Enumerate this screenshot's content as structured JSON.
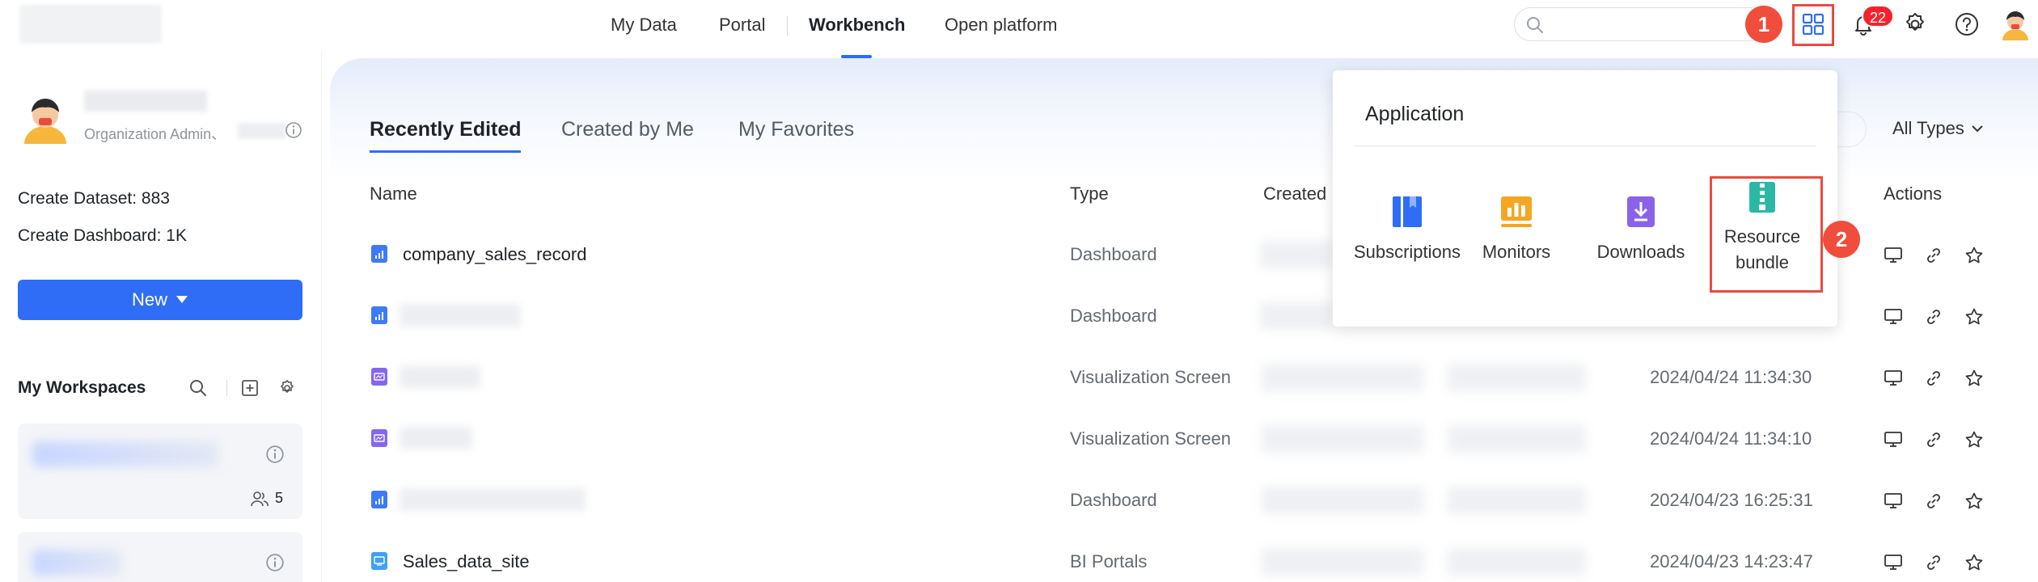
{
  "nav": {
    "items": [
      {
        "label": "My Data",
        "active": false
      },
      {
        "label": "Portal",
        "active": false
      },
      {
        "label": "Workbench",
        "active": true
      },
      {
        "label": "Open platform",
        "active": false
      }
    ]
  },
  "header": {
    "search_placeholder": "",
    "notification_count": "22",
    "markers": [
      "1",
      "2"
    ],
    "icons": [
      "search-icon",
      "apps-grid-icon",
      "bell-icon",
      "settings-icon",
      "help-icon",
      "avatar"
    ]
  },
  "profile": {
    "role": "Organization Admin、",
    "stats": {
      "dataset_label": "Create Dataset:",
      "dataset_value": "883",
      "dashboard_label": "Create Dashboard:",
      "dashboard_value": "1K"
    }
  },
  "sidebar": {
    "new_label": "New",
    "workspaces_title": "My Workspaces",
    "workspace_cards": [
      {
        "members": "5"
      },
      {
        "members": ""
      }
    ]
  },
  "main": {
    "tabs": [
      {
        "label": "Recently Edited",
        "active": true
      },
      {
        "label": "Created by Me",
        "active": false
      },
      {
        "label": "My Favorites",
        "active": false
      }
    ],
    "filter_label": "All Types",
    "columns": [
      "Name",
      "Type",
      "Created",
      "Actions"
    ],
    "rows": [
      {
        "name": "company_sales_record",
        "type": "Dashboard",
        "icon": "dashboard-icon",
        "date": ""
      },
      {
        "name": "",
        "type": "Dashboard",
        "icon": "dashboard-icon",
        "date": ""
      },
      {
        "name": "",
        "type": "Visualization Screen",
        "icon": "visualization-screen-icon",
        "date": "2024/04/24 11:34:30"
      },
      {
        "name": "",
        "type": "Visualization Screen",
        "icon": "visualization-screen-icon",
        "date": "2024/04/24 11:34:10"
      },
      {
        "name": "",
        "type": "Dashboard",
        "icon": "dashboard-icon",
        "date": "2024/04/23 16:25:31"
      },
      {
        "name": "Sales_data_site",
        "type": "BI Portals",
        "icon": "bi-portal-icon",
        "date": "2024/04/23 14:23:47"
      }
    ]
  },
  "popup": {
    "title": "Application",
    "apps": [
      {
        "label": "Subscriptions",
        "icon": "subscriptions-icon",
        "color": "#2f6df6"
      },
      {
        "label": "Monitors",
        "icon": "monitors-icon",
        "color": "#f5a623"
      },
      {
        "label": "Downloads",
        "icon": "downloads-icon",
        "color": "#8a63e8"
      },
      {
        "label_line1": "Resource",
        "label_line2": "bundle",
        "icon": "resource-bundle-icon",
        "color": "#2cb8a6"
      }
    ]
  },
  "colors": {
    "accent": "#2f6df6",
    "marker": "#f04d3c",
    "highlight": "#ea4b40",
    "badge": "#f5222d"
  }
}
